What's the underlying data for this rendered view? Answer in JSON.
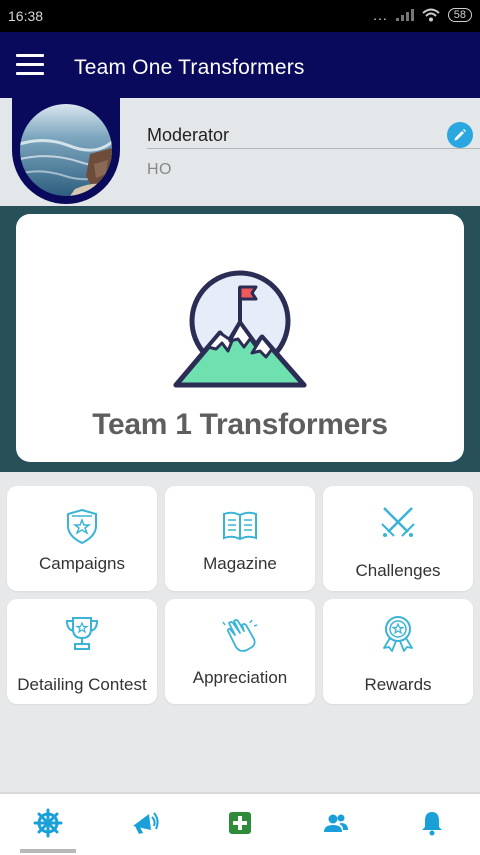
{
  "status_bar": {
    "time": "16:38",
    "battery": "58",
    "dots": "...",
    "indicators": [
      "signal-icon",
      "wifi-icon",
      "battery-icon"
    ]
  },
  "app_bar": {
    "title": "Team One Transformers",
    "menu_icon": "hamburger-menu-icon"
  },
  "profile": {
    "name": "Moderator",
    "org": "HO",
    "edit_icon": "pencil-icon"
  },
  "banner": {
    "title": "Team 1 Transformers",
    "logo_icon": "mountain-flag-logo"
  },
  "tiles": [
    {
      "label": "Campaigns",
      "icon": "shield-star-icon"
    },
    {
      "label": "Magazine",
      "icon": "open-book-icon"
    },
    {
      "label": "Challenges",
      "icon": "crossed-swords-icon"
    },
    {
      "label": "Detailing Contest",
      "icon": "trophy-icon"
    },
    {
      "label": "Appreciation",
      "icon": "clapping-hands-icon"
    },
    {
      "label": "Rewards",
      "icon": "medal-badge-icon"
    }
  ],
  "bottom_nav": [
    {
      "icon": "wheel-icon",
      "active": true
    },
    {
      "icon": "megaphone-icon"
    },
    {
      "icon": "add-box-icon"
    },
    {
      "icon": "people-icon"
    },
    {
      "icon": "bell-icon"
    }
  ],
  "colors": {
    "app_bar": "#0a0a5c",
    "accent": "#2aa6e0",
    "banner_bg": "#275058",
    "tile_icon": "#3ab3d6"
  }
}
